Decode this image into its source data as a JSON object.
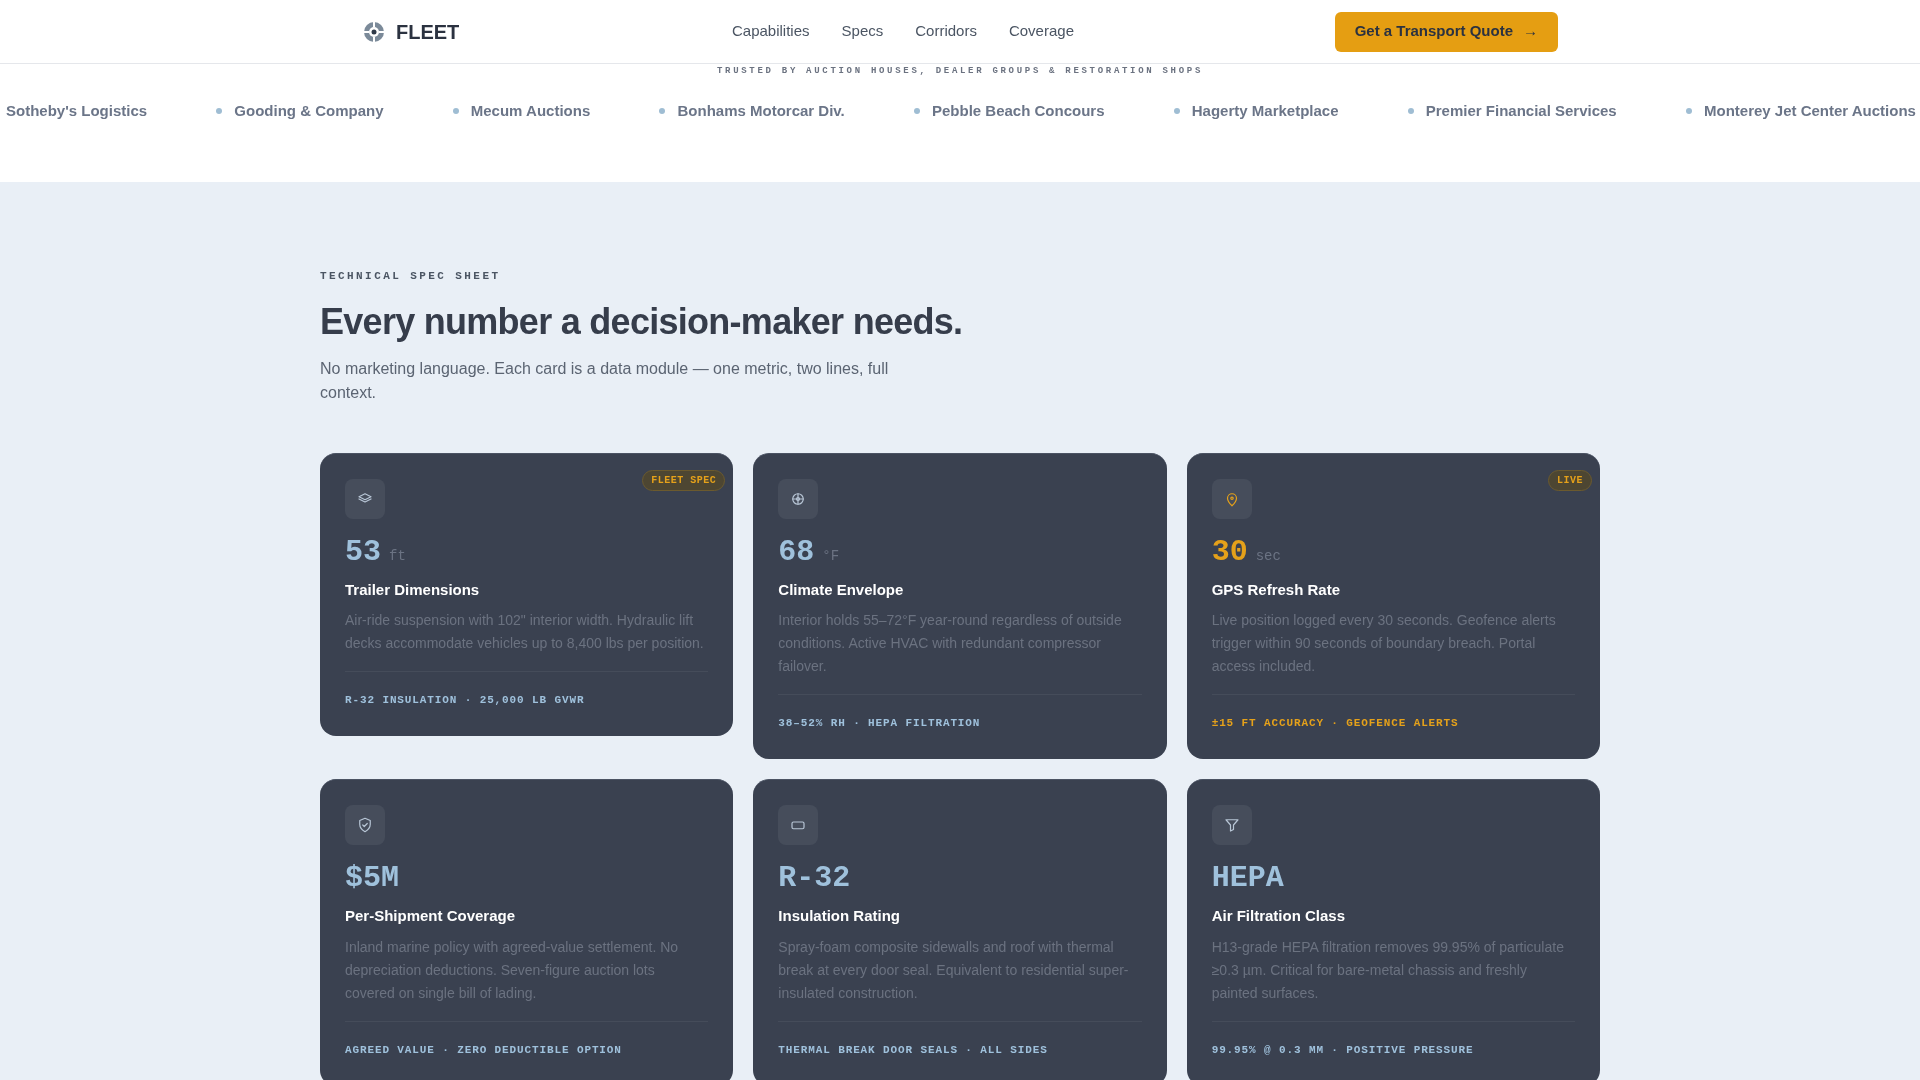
{
  "header": {
    "brand": "FLEET",
    "nav": [
      "Capabilities",
      "Specs",
      "Corridors",
      "Coverage"
    ],
    "cta": "Get a Transport Quote",
    "cta_arrow": "→"
  },
  "trust_strip": {
    "label": "TRUSTED BY AUCTION HOUSES, DEALER GROUPS & RESTORATION SHOPS",
    "partners": [
      "Sotheby's Logistics",
      "Gooding & Company",
      "Mecum Auctions",
      "Bonhams Motorcar Div.",
      "Pebble Beach Concours",
      "Hagerty Marketplace",
      "Premier Financial Services",
      "Monterey Jet Center Auctions"
    ]
  },
  "section": {
    "eyebrow": "TECHNICAL SPEC SHEET",
    "title": "Every number a decision-maker needs.",
    "intro": "No marketing language. Each card is a data module — one metric, two lines, full context."
  },
  "cards": [
    {
      "value": "53",
      "unit": "ft",
      "title": "Trailer Dimensions",
      "description": "Air-ride suspension with 102\" interior width. Hydraulic lift decks accommodate vehicles up to 8,400 lbs per position.",
      "footer": "R-32 INSULATION · 25,000 LB GVWR",
      "badge": "FLEET SPEC",
      "highlight": false
    },
    {
      "value": "68",
      "unit": "°F",
      "title": "Climate Envelope",
      "description": "Interior holds 55–72°F year-round regardless of outside conditions. Active HVAC with redundant compressor failover.",
      "footer": "38–52% RH · HEPA FILTRATION",
      "highlight": false
    },
    {
      "value": "30",
      "unit": "sec",
      "title": "GPS Refresh Rate",
      "description": "Live position logged every 30 seconds. Geofence alerts trigger within 90 seconds of boundary breach. Portal access included.",
      "footer": "±15 FT ACCURACY · GEOFENCE ALERTS",
      "badge": "LIVE",
      "highlight": true
    },
    {
      "value": "$5M",
      "title": "Per-Shipment Coverage",
      "description": "Inland marine policy with agreed-value settlement. No depreciation deductions. Seven-figure auction lots covered on single bill of lading.",
      "footer": "AGREED VALUE · ZERO DEDUCTIBLE OPTION",
      "highlight": false
    },
    {
      "value": "R-32",
      "title": "Insulation Rating",
      "description": "Spray-foam composite sidewalls and roof with thermal break at every door seal. Equivalent to residential super-insulated construction.",
      "footer": "THERMAL BREAK DOOR SEALS · ALL SIDES",
      "highlight": false
    },
    {
      "value": "HEPA",
      "title": "Air Filtration Class",
      "description": "H13-grade HEPA filtration removes 99.95% of particulate ≥0.3 µm. Critical for bare-metal chassis and freshly painted surfaces.",
      "footer": "99.95% @ 0.3 MM · POSITIVE PRESSURE",
      "highlight": false
    }
  ]
}
